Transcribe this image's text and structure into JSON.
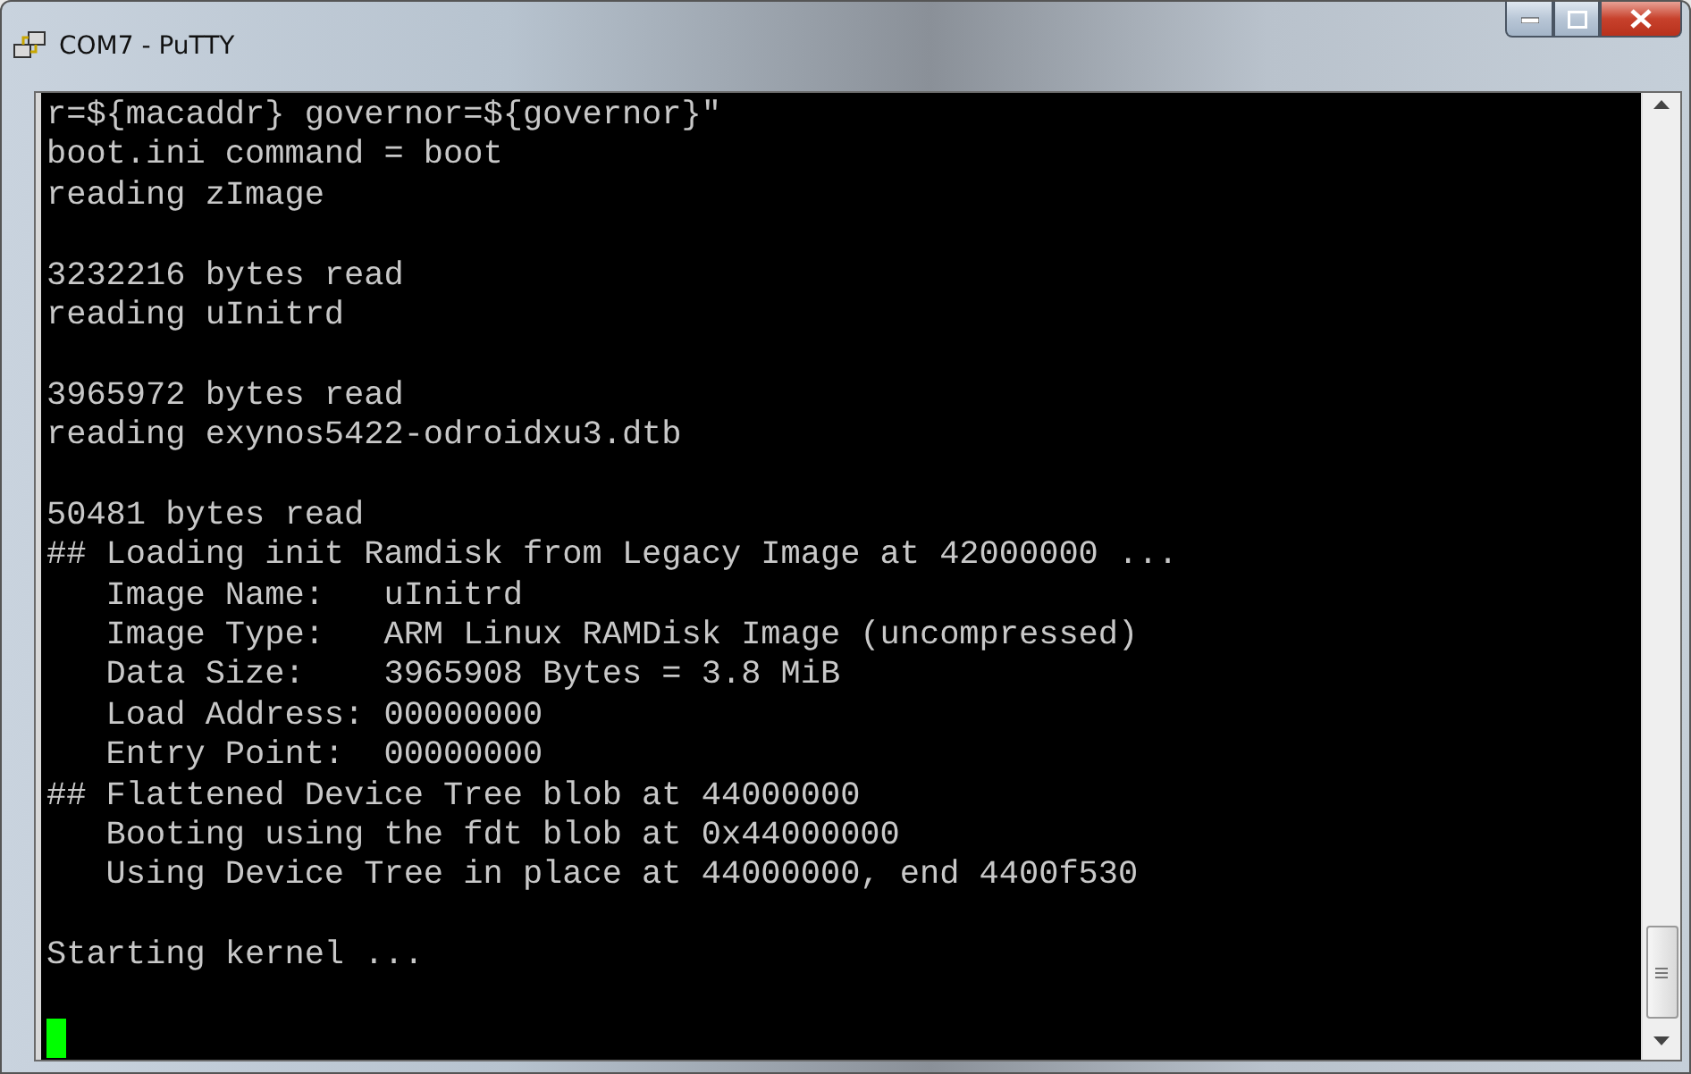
{
  "window": {
    "title": "COM7 - PuTTY"
  },
  "terminal": {
    "lines": [
      {
        "kind": "text",
        "text": "r=${macaddr} governor=${governor}\""
      },
      {
        "kind": "text",
        "text": "boot.ini command = boot"
      },
      {
        "kind": "text",
        "text": "reading zImage"
      },
      {
        "kind": "blank"
      },
      {
        "kind": "text",
        "text": "3232216 bytes read"
      },
      {
        "kind": "text",
        "text": "reading uInitrd"
      },
      {
        "kind": "blank"
      },
      {
        "kind": "text",
        "text": "3965972 bytes read"
      },
      {
        "kind": "text",
        "text": "reading exynos5422-odroidxu3.dtb"
      },
      {
        "kind": "blank"
      },
      {
        "kind": "text",
        "text": "50481 bytes read"
      },
      {
        "kind": "text",
        "text": "## Loading init Ramdisk from Legacy Image at 42000000 ..."
      },
      {
        "kind": "text",
        "text": "   Image Name:   uInitrd"
      },
      {
        "kind": "text",
        "text": "   Image Type:   ARM Linux RAMDisk Image (uncompressed)"
      },
      {
        "kind": "text",
        "text": "   Data Size:    3965908 Bytes = 3.8 MiB"
      },
      {
        "kind": "text",
        "text": "   Load Address: 00000000"
      },
      {
        "kind": "text",
        "text": "   Entry Point:  00000000"
      },
      {
        "kind": "text",
        "text": "## Flattened Device Tree blob at 44000000"
      },
      {
        "kind": "text",
        "text": "   Booting using the fdt blob at 0x44000000"
      },
      {
        "kind": "text",
        "text": "   Using Device Tree in place at 44000000, end 4400f530"
      },
      {
        "kind": "blank"
      },
      {
        "kind": "text",
        "text": "Starting kernel ..."
      },
      {
        "kind": "blank"
      },
      {
        "kind": "cursor"
      }
    ]
  }
}
